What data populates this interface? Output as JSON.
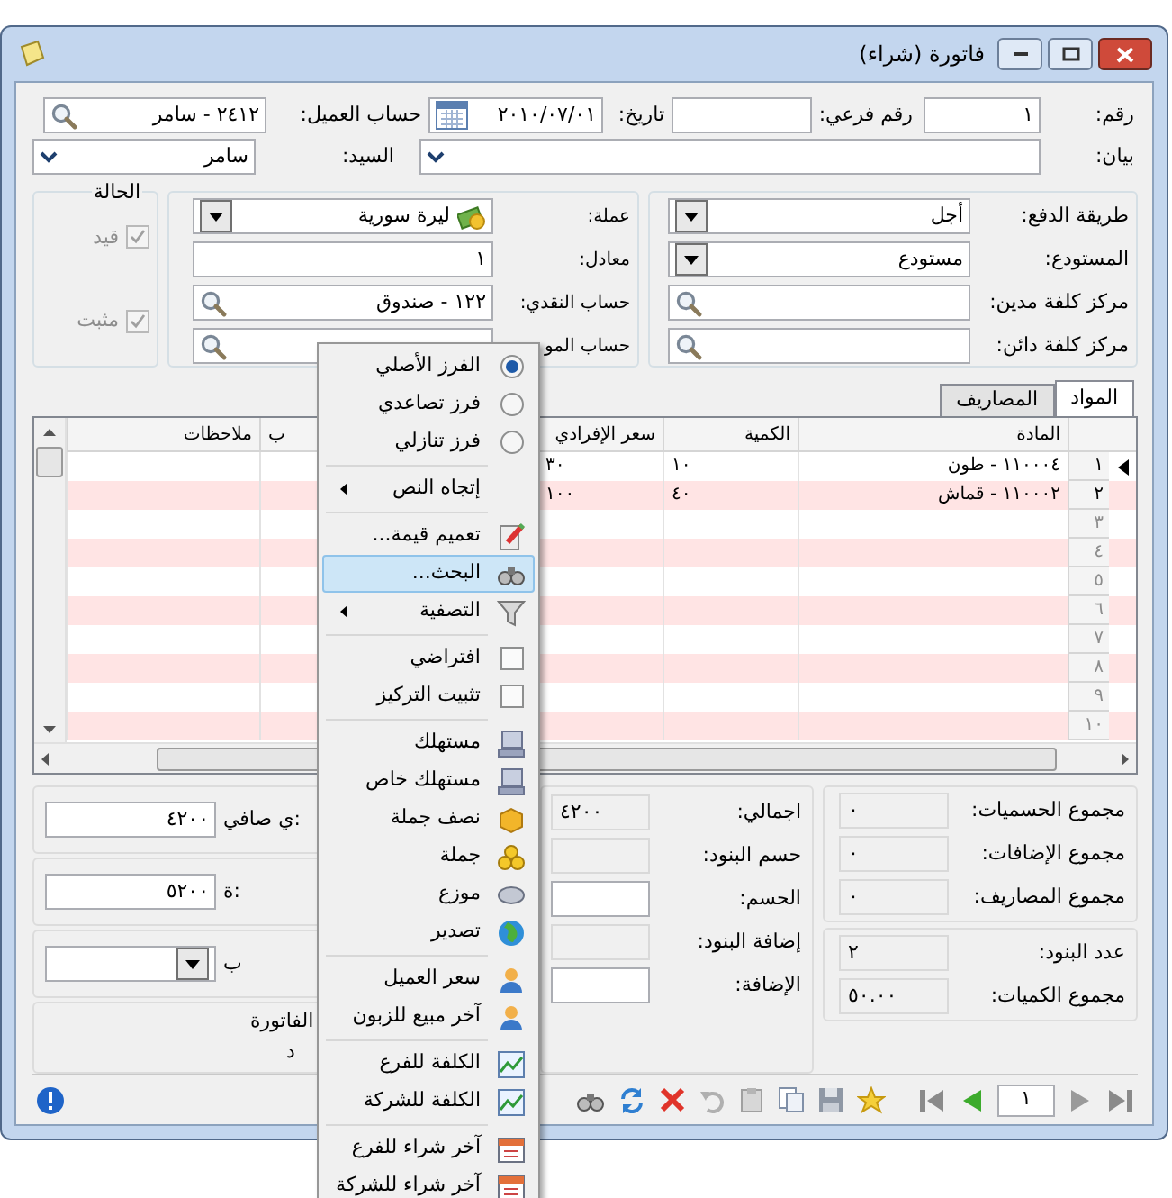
{
  "window": {
    "title": "فاتورة (شراء)"
  },
  "header": [
    {
      "label": "رقم:",
      "value": "١",
      "kind": "text"
    },
    {
      "label": "رقم فرعي:",
      "kind": "text"
    },
    {
      "label": "تاريخ:",
      "value": "٢٠١٠/٠٧/٠١",
      "kind": "date"
    },
    {
      "label": "حساب العميل:",
      "value": "٢٤١٢ - سامر",
      "kind": "lookup"
    }
  ],
  "header_row_2": [
    {
      "label": "بيان:",
      "kind": "dropdown"
    },
    {
      "label": "السيد:",
      "value": "سامر",
      "kind": "dropdown"
    }
  ],
  "payment_group": [
    {
      "label": "طريقة الدفع:",
      "value": "أجل",
      "kind": "combo"
    },
    {
      "label": "المستودع:",
      "value": "مستودع",
      "kind": "combo"
    },
    {
      "label": "مركز كلفة مدين:",
      "kind": "lookup"
    },
    {
      "label": "مركز كلفة دائن:",
      "kind": "lookup"
    }
  ],
  "currency_group": [
    {
      "label": "عملة:",
      "value": "ليرة سورية",
      "kind": "combo"
    },
    {
      "label": "معادل:",
      "value": "١",
      "kind": "text"
    },
    {
      "label": "حساب النقدي:",
      "value": "١٢٢ - صندوق",
      "kind": "lookup"
    },
    {
      "label": "حساب المو",
      "kind": "lookup"
    }
  ],
  "status_group": {
    "title": "الحالة",
    "checks": [
      {
        "label": "قيد",
        "checked": true,
        "disabled": true
      },
      {
        "label": "مثبت",
        "checked": true,
        "disabled": true
      }
    ]
  },
  "tabs": [
    {
      "label": "المواد",
      "selected": true
    },
    {
      "label": "المصاريف",
      "selected": false
    }
  ],
  "table": {
    "columns": [
      "المادة",
      "الكمية",
      "سعر الإفرادي",
      "ب",
      "ملاحظات"
    ],
    "rows": [
      {
        "number": "١",
        "current": true,
        "item": "١١٠٠٠٤ - طون",
        "quantity": "١٠",
        "unit_price": "٣٠"
      },
      {
        "number": "٢",
        "current": false,
        "item": "١١٠٠٠٢ - قماش",
        "quantity": "٤٠",
        "unit_price": "١٠٠"
      },
      {
        "number": "٣",
        "current": false
      },
      {
        "number": "٤",
        "current": false
      },
      {
        "number": "٥",
        "current": false
      },
      {
        "number": "٦",
        "current": false
      },
      {
        "number": "٧",
        "current": false
      },
      {
        "number": "٨",
        "current": false
      },
      {
        "number": "٩",
        "current": false
      },
      {
        "number": "١٠",
        "current": false
      }
    ]
  },
  "summary_groups": [
    [
      {
        "label": "مجموع الحسميات:",
        "value": "٠"
      },
      {
        "label": "مجموع الإضافات:",
        "value": "٠"
      },
      {
        "label": "مجموع المصاريف:",
        "value": "٠"
      }
    ],
    [
      {
        "label": "عدد البنود:",
        "value": "٢"
      },
      {
        "label": "مجموع الكميات:",
        "value": "٥٠.٠٠"
      }
    ]
  ],
  "totals": [
    {
      "label": "اجمالي:",
      "value": "٤٢٠٠",
      "readonly": true
    },
    {
      "label": "حسم البنود:",
      "readonly": true
    },
    {
      "label": "الحسم:",
      "readonly": false
    },
    {
      "label": "إضافة البنود:",
      "readonly": true
    },
    {
      "label": "الإضافة:",
      "readonly": false
    }
  ],
  "net": [
    {
      "label": "ي صافي:",
      "value": "٤٢٠٠",
      "kind": "text"
    },
    {
      "label": "ة:",
      "value": "٥٢٠٠",
      "kind": "text"
    },
    {
      "label": "ب",
      "kind": "combo"
    }
  ],
  "invoice_group": {
    "title": "الفاتورة",
    "text": "د"
  },
  "toolbar": {
    "page": "١"
  },
  "context_menu": [
    {
      "kind": "radio",
      "label": "الفرز الأصلي",
      "selected": true
    },
    {
      "kind": "radio",
      "label": "فرز تصاعدي",
      "selected": false
    },
    {
      "kind": "radio",
      "label": "فرز تنازلي",
      "selected": false
    },
    {
      "kind": "separator"
    },
    {
      "kind": "submenu",
      "label": "إتجاه النص"
    },
    {
      "kind": "separator"
    },
    {
      "kind": "command",
      "label": "تعميم قيمة...",
      "highlighted": false
    },
    {
      "kind": "command",
      "label": "البحث...",
      "highlighted": true
    },
    {
      "kind": "submenu",
      "label": "التصفية"
    },
    {
      "kind": "separator"
    },
    {
      "kind": "checkbox",
      "label": "افتراضي",
      "checked": false
    },
    {
      "kind": "checkbox",
      "label": "تثبيت التركيز",
      "checked": false
    },
    {
      "kind": "separator"
    },
    {
      "kind": "command",
      "label": "مستهلك",
      "highlighted": false
    },
    {
      "kind": "command",
      "label": "مستهلك خاص",
      "highlighted": false
    },
    {
      "kind": "command",
      "label": "نصف جملة",
      "highlighted": false
    },
    {
      "kind": "command",
      "label": "جملة",
      "highlighted": false
    },
    {
      "kind": "command",
      "label": "موزع",
      "highlighted": false
    },
    {
      "kind": "command",
      "label": "تصدير",
      "highlighted": false
    },
    {
      "kind": "separator"
    },
    {
      "kind": "command",
      "label": "سعر العميل",
      "highlighted": false
    },
    {
      "kind": "command",
      "label": "آخر مبيع للزبون",
      "highlighted": false
    },
    {
      "kind": "separator"
    },
    {
      "kind": "command",
      "label": "الكلفة للفرع",
      "highlighted": false
    },
    {
      "kind": "command",
      "label": "الكلفة للشركة",
      "highlighted": false
    },
    {
      "kind": "separator"
    },
    {
      "kind": "command",
      "label": "آخر شراء للفرع",
      "highlighted": false
    },
    {
      "kind": "command",
      "label": "آخر شراء للشركة",
      "highlighted": false
    }
  ]
}
